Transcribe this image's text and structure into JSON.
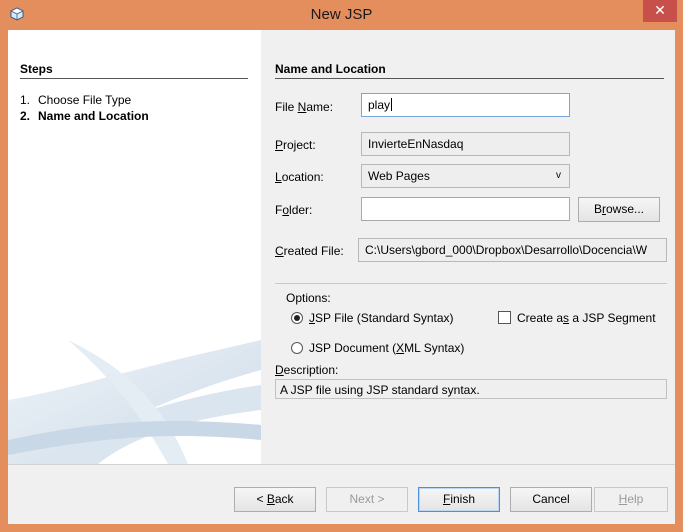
{
  "window": {
    "title": "New JSP",
    "close_label": "✕",
    "accent": "#e48e5e",
    "close_color": "#c7504a"
  },
  "steps": {
    "title": "Steps",
    "items": [
      {
        "num": "1.",
        "label": "Choose File Type",
        "current": false
      },
      {
        "num": "2.",
        "label": "Name and Location",
        "current": true
      }
    ]
  },
  "form": {
    "title": "Name and Location",
    "file_name": {
      "label_pre": "File ",
      "label_key": "N",
      "label_post": "ame:",
      "value": "play"
    },
    "project": {
      "label_key": "P",
      "label_post": "roject:",
      "value": "InvierteEnNasdaq"
    },
    "location": {
      "label_key": "L",
      "label_post": "ocation:",
      "value": "Web Pages",
      "arrow": "v"
    },
    "folder": {
      "label_pre": "F",
      "label_key": "o",
      "label_post": "lder:",
      "value": "",
      "browse_pre": "B",
      "browse_key": "r",
      "browse_post": "owse..."
    },
    "created_file": {
      "label_key": "C",
      "label_post": "reated File:",
      "value": "C:\\Users\\gbord_000\\Dropbox\\Desarrollo\\Docencia\\W"
    }
  },
  "options": {
    "label": "Options:",
    "jsp_file": {
      "key": "J",
      "post": "SP File (Standard Syntax)",
      "checked": true
    },
    "segment": {
      "pre": "Create a",
      "key": "s",
      "post": " a JSP Segment",
      "checked": false
    },
    "jsp_document": {
      "pre": "JSP Document (",
      "key": "X",
      "post": "ML Syntax)",
      "checked": false
    }
  },
  "description": {
    "label_key": "D",
    "label_post": "escription:",
    "text": "A JSP file using JSP standard syntax."
  },
  "buttons": {
    "back": {
      "pre": "< ",
      "key": "B",
      "post": "ack"
    },
    "next": "Next >",
    "finish": {
      "key": "F",
      "post": "inish"
    },
    "cancel": "Cancel",
    "help": {
      "key": "H",
      "post": "elp"
    }
  }
}
